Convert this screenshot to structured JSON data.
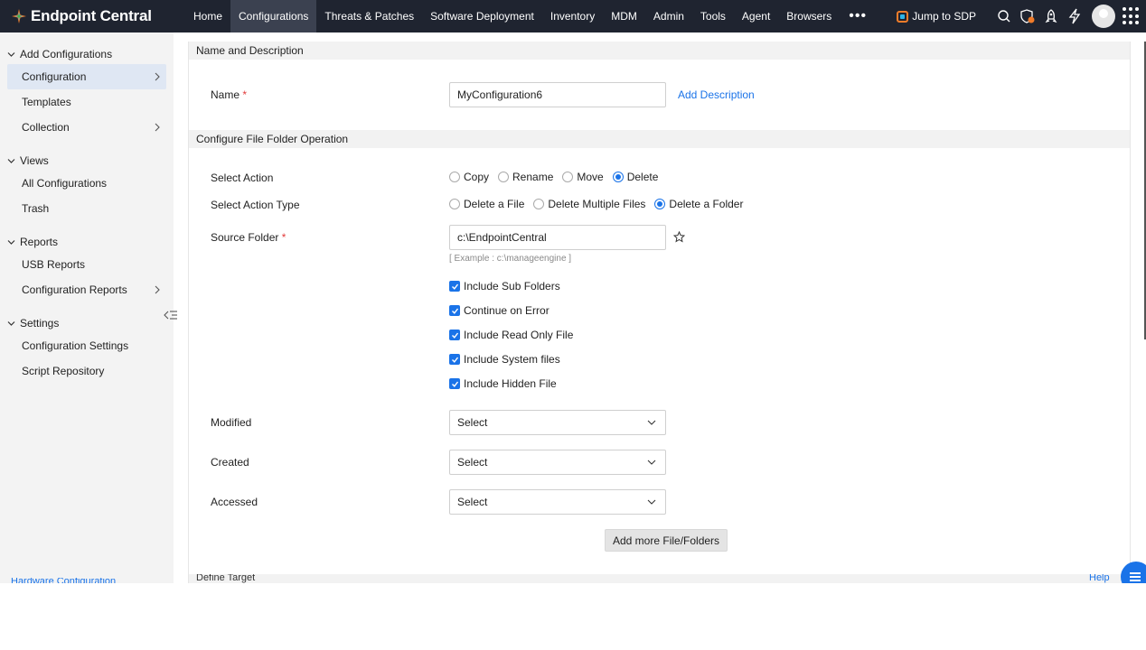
{
  "header": {
    "app_name": "Endpoint Central",
    "nav": [
      "Home",
      "Configurations",
      "Threats & Patches",
      "Software Deployment",
      "Inventory",
      "MDM",
      "Admin",
      "Tools",
      "Agent",
      "Browsers"
    ],
    "active_nav": "Configurations",
    "more_label": "•••",
    "jump_label": "Jump to SDP"
  },
  "sidebar": {
    "sections": [
      {
        "title": "Add Configurations",
        "items": [
          "Configuration",
          "Templates",
          "Collection"
        ]
      },
      {
        "title": "Views",
        "items": [
          "All Configurations",
          "Trash"
        ]
      },
      {
        "title": "Reports",
        "items": [
          "USB Reports",
          "Configuration Reports"
        ]
      },
      {
        "title": "Settings",
        "items": [
          "Configuration Settings",
          "Script Repository"
        ]
      }
    ],
    "active_item": "Configuration",
    "footer_text": "Hardware Configuration"
  },
  "form": {
    "section1_title": "Name and Description",
    "name_label": "Name",
    "required_mark": "*",
    "name_value": "MyConfiguration6",
    "add_description": "Add Description",
    "section2_title": "Configure File Folder Operation",
    "select_action_label": "Select Action",
    "actions": [
      "Copy",
      "Rename",
      "Move",
      "Delete"
    ],
    "selected_action": "Delete",
    "action_type_label": "Select Action Type",
    "action_types": [
      "Delete a File",
      "Delete Multiple Files",
      "Delete a Folder"
    ],
    "selected_action_type": "Delete a Folder",
    "source_folder_label": "Source Folder",
    "source_folder_value": "c:\\EndpointCentral",
    "source_folder_hint": "[ Example : c:\\manageengine ]",
    "checkboxes": [
      "Include Sub Folders",
      "Continue on Error",
      "Include Read Only File",
      "Include System files",
      "Include Hidden File"
    ],
    "modified_label": "Modified",
    "created_label": "Created",
    "accessed_label": "Accessed",
    "select_placeholder": "Select",
    "add_more_button": "Add more File/Folders",
    "next_section_title": "Define Target",
    "help_text": "Help"
  }
}
